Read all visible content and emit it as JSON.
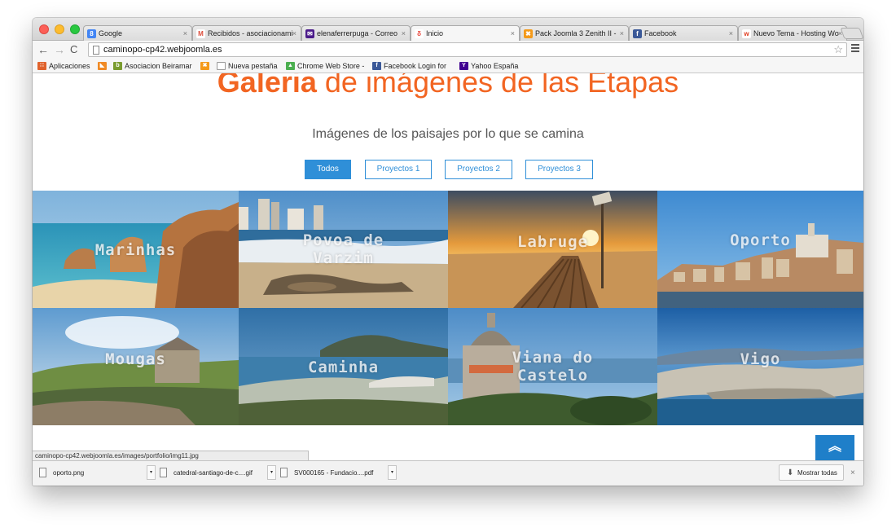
{
  "tabs": [
    {
      "label": "Google",
      "icon": "google-icon",
      "color": "#4285f4",
      "glyph": "8"
    },
    {
      "label": "Recibidos - asociacionami",
      "icon": "gmail-icon",
      "color": "#dd4b39",
      "glyph": "M"
    },
    {
      "label": "elenaferrerpuga - Correo",
      "icon": "yahoo-mail-icon",
      "color": "#4b1b8a",
      "glyph": "✉"
    },
    {
      "label": "Inicio",
      "icon": "joomla-flame-icon",
      "color": "#e8463b",
      "glyph": "δ"
    },
    {
      "label": "Pack Joomla 3 Zenith II -",
      "icon": "joomla-icon",
      "color": "#f49a1a",
      "glyph": "✖"
    },
    {
      "label": "Facebook",
      "icon": "facebook-icon",
      "color": "#3b5998",
      "glyph": "f"
    },
    {
      "label": "Nuevo Tema - Hosting Wo",
      "icon": "webempresa-icon",
      "color": "#e03a1e",
      "glyph": "w"
    }
  ],
  "address": {
    "url": "caminopo-cp42.webjoomla.es"
  },
  "bookmarks": [
    {
      "label": "Aplicaciones",
      "icon": "apps-grid-icon",
      "color": "#e0622c",
      "glyph": "∷"
    },
    {
      "label": "",
      "icon": "feed-icon",
      "color": "#f08a24",
      "glyph": "◣"
    },
    {
      "label": "Asociacion Beiramar",
      "icon": "beiramar-icon",
      "color": "#7a9c2f",
      "glyph": "b"
    },
    {
      "label": "",
      "icon": "joomla-icon",
      "color": "#f49a1a",
      "glyph": "✖"
    },
    {
      "label": "Nueva pestaña",
      "icon": "page-icon",
      "color": "#bbbbbb",
      "glyph": ""
    },
    {
      "label": "Chrome Web Store -",
      "icon": "chrome-store-icon",
      "color": "#4caf50",
      "glyph": "▲"
    },
    {
      "label": "Facebook Login for",
      "icon": "facebook-icon",
      "color": "#3b5998",
      "glyph": "f"
    },
    {
      "label": "Yahoo España",
      "icon": "yahoo-icon",
      "color": "#400090",
      "glyph": "Y"
    }
  ],
  "page": {
    "title_bold": "Galeria",
    "title_rest": " de imágenes de las Etapas",
    "subtitle": "Imágenes de los paisajes por lo que se camina",
    "filters": [
      "Todos",
      "Proyectos 1",
      "Proyectos 2",
      "Proyectos 3"
    ],
    "accent_color": "#f26522",
    "button_color": "#2f8fd8"
  },
  "gallery": [
    {
      "label": "Marinhas"
    },
    {
      "label": "Povoa de\nVarzim"
    },
    {
      "label": "Labruge"
    },
    {
      "label": "Oporto"
    },
    {
      "label": "Mougas"
    },
    {
      "label": "Caminha"
    },
    {
      "label": "Viana do\nCastelo"
    },
    {
      "label": "Vigo"
    }
  ],
  "status_url": "caminopo-cp42.webjoomla.es/images/portfolio/img11.jpg",
  "downloads": [
    {
      "name": "oporto.png"
    },
    {
      "name": "catedral-santiago-de-c....gif"
    },
    {
      "name": "SV000165 - Fundacio....pdf"
    }
  ],
  "show_all_label": "Mostrar todas"
}
